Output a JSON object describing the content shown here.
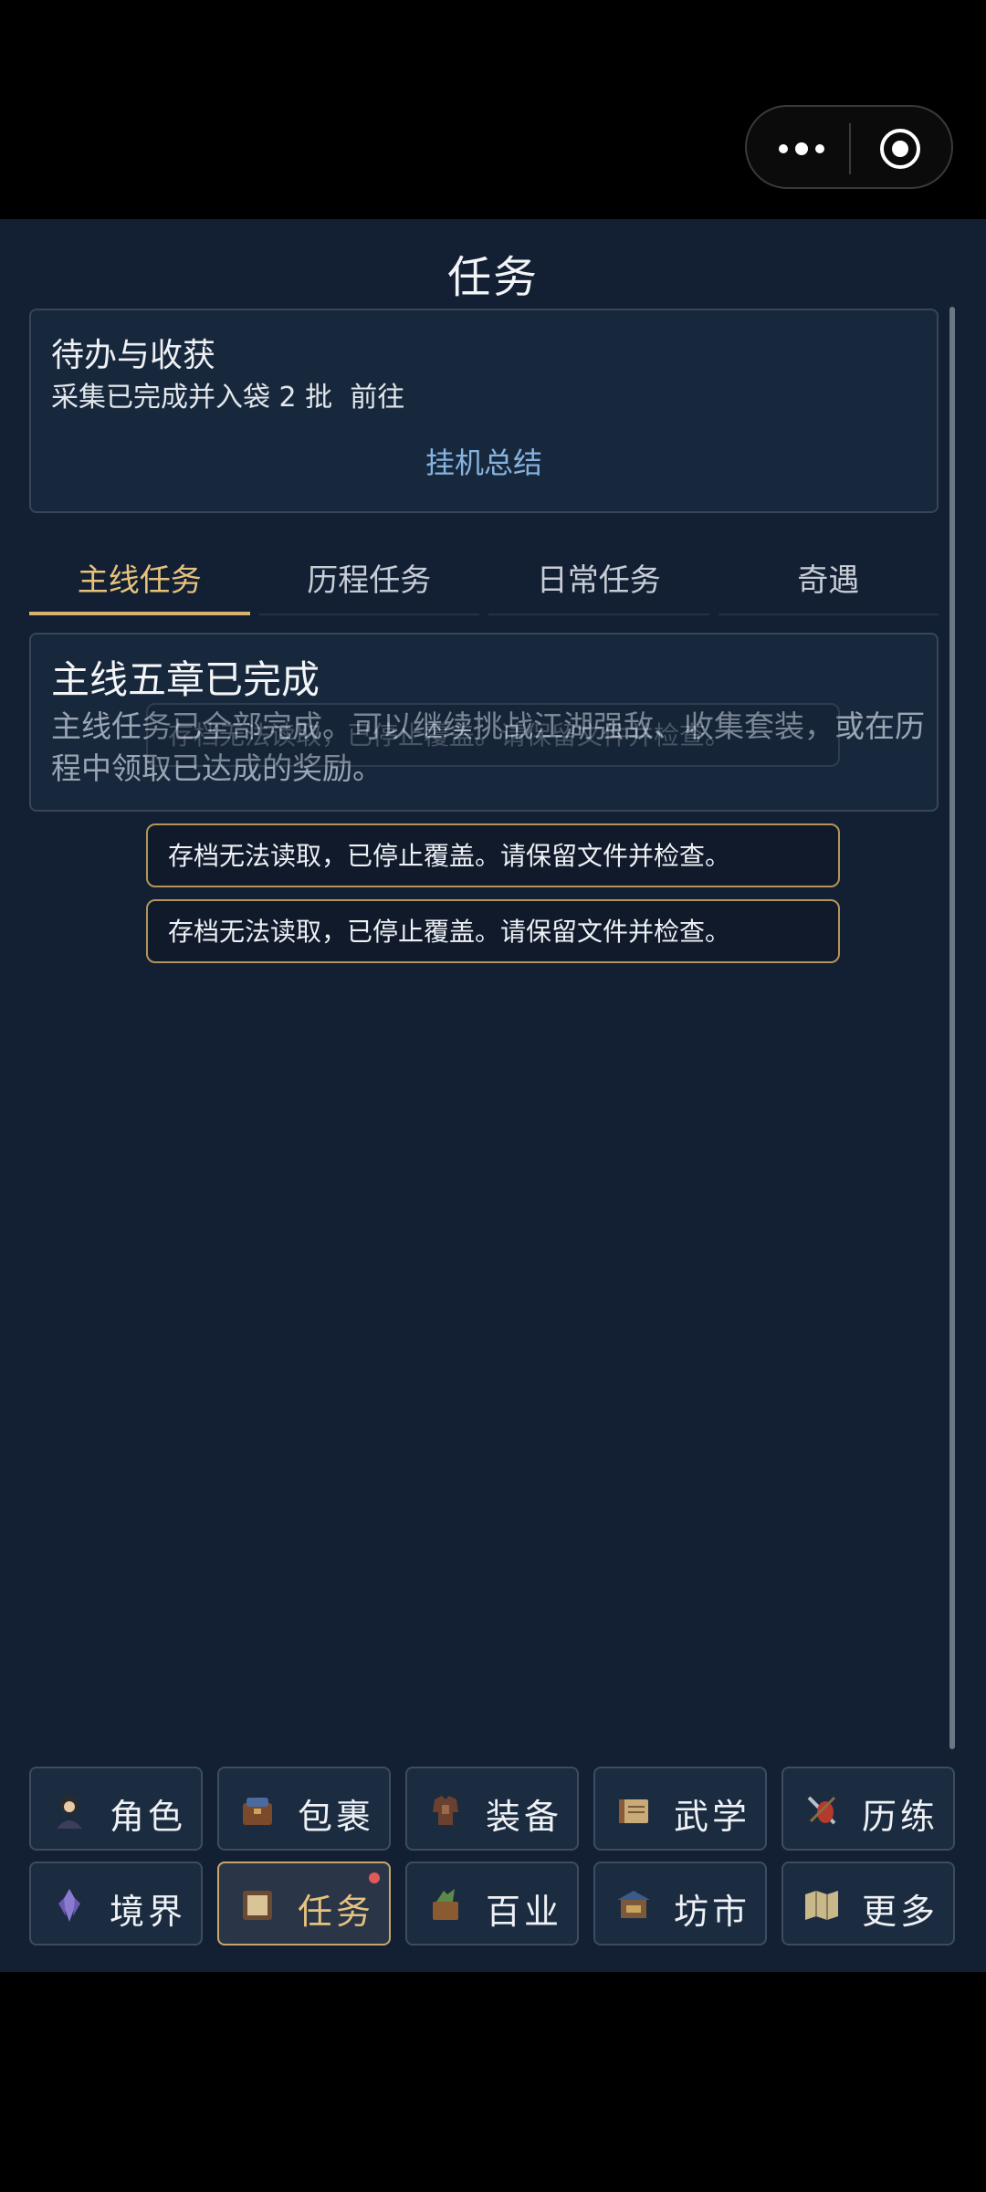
{
  "header": {
    "title": "任务"
  },
  "capsule": {
    "more_icon": "more-dots-icon",
    "close_icon": "target-circle-icon"
  },
  "todo": {
    "title": "待办与收获",
    "line": "采集已完成并入袋 2 批  前往",
    "link": "挂机总结"
  },
  "tabs": [
    {
      "label": "主线任务",
      "active": true
    },
    {
      "label": "历程任务",
      "active": false
    },
    {
      "label": "日常任务",
      "active": false
    },
    {
      "label": "奇遇",
      "active": false
    }
  ],
  "quest": {
    "title": "主线五章已完成",
    "description": "主线任务已全部完成。可以继续挑战江湖强敌、收集套装，或在历程中领取已达成的奖励。"
  },
  "toasts": [
    {
      "text": "存档无法读取，已停止覆盖。请保留文件并检查。"
    },
    {
      "text": "存档无法读取，已停止覆盖。请保留文件并检查。"
    },
    {
      "text": "存档无法读取，已停止覆盖。请保留文件并检查。"
    }
  ],
  "nav": {
    "items": [
      {
        "label": "角色",
        "icon": "character-portrait-icon"
      },
      {
        "label": "包裹",
        "icon": "bag-icon"
      },
      {
        "label": "装备",
        "icon": "armor-icon"
      },
      {
        "label": "武学",
        "icon": "scroll-book-icon"
      },
      {
        "label": "历练",
        "icon": "crossed-weapons-icon"
      },
      {
        "label": "境界",
        "icon": "crystal-icon"
      },
      {
        "label": "任务",
        "icon": "quest-scroll-icon",
        "active": true,
        "badge": true
      },
      {
        "label": "百业",
        "icon": "craft-chest-icon"
      },
      {
        "label": "坊市",
        "icon": "market-stall-icon"
      },
      {
        "label": "更多",
        "icon": "map-icon"
      }
    ]
  },
  "colors": {
    "background": "#132033",
    "accent_gold": "#e7c27d",
    "link_blue": "#86b3e0",
    "badge_red": "#e05a5a"
  }
}
